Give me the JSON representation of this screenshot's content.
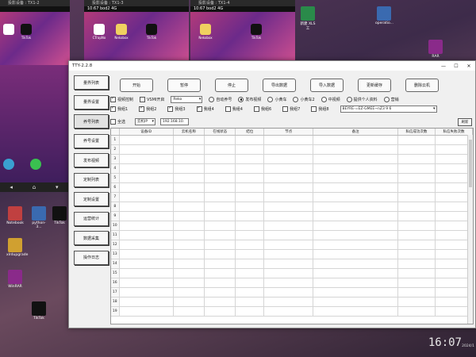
{
  "phones": [
    {
      "title": "投影设备 : TX1-2",
      "time": "",
      "apps": [
        {
          "label": ""
        },
        {
          "label": "TikTok"
        }
      ]
    },
    {
      "title": "投影设备 : TX1-3",
      "time": "10:67 bod2 4G",
      "apps": [
        {
          "label": "CTrapNo"
        },
        {
          "label": "TikTok"
        },
        {
          "label": "Nekobox"
        }
      ]
    },
    {
      "title": "投影设备 : TX1-4",
      "time": "10:67 bod2 4G",
      "apps": [
        {
          "label": "Nekobox"
        },
        {
          "label": "TikTok"
        }
      ]
    }
  ],
  "window": {
    "title": "TTY-2.2.8",
    "controls": {
      "min": "—",
      "max": "☐",
      "close": "✕"
    }
  },
  "sidebar": [
    {
      "label": "量界列表"
    },
    {
      "label": "量界设置"
    },
    {
      "label": "养号列表"
    },
    {
      "label": "养号设置"
    },
    {
      "label": "发布视频"
    },
    {
      "label": "定制列表"
    },
    {
      "label": "定制设置"
    },
    {
      "label": "运营统计"
    },
    {
      "label": "数据采集"
    },
    {
      "label": "操作日志"
    }
  ],
  "toolbar": [
    {
      "label": "开始"
    },
    {
      "label": "暂停"
    },
    {
      "label": "停止"
    },
    {
      "label": "导出数据"
    },
    {
      "label": "导入数据"
    },
    {
      "label": "更新缓存"
    },
    {
      "label": "删除云机"
    }
  ],
  "options_row1": {
    "cb1": "视频控制",
    "cb2": "VSMI开启",
    "select_value": "Reko",
    "r1": "自动养号",
    "r2": "发布视频",
    "r3": "小黄车",
    "r4": "小黄车2",
    "r5": "中视频",
    "r6": "提供个人资料",
    "r7": "营销"
  },
  "options_row2": {
    "cb1": "我组1",
    "cb2": "我组2",
    "cb3": "我组3",
    "cb4": "我组4",
    "cb5": "我组4",
    "cb6": "我组6",
    "cb7": "我组7",
    "cb8": "我组8",
    "select_value": "BEYRE-=EZ-GMEE~nZ3 9 6"
  },
  "filter_row": {
    "all": "全选",
    "ip_label": "云机IP",
    "ip_value": "192.168.10.",
    "refresh": "刷新"
  },
  "grid": {
    "columns": [
      "",
      "设备ID",
      "云机名称",
      "在线状态",
      "结位",
      "节点",
      "备注",
      "私信成功次数",
      "私信失败次数"
    ],
    "rows": [
      "1",
      "2",
      "3",
      "4",
      "5",
      "6",
      "7",
      "8",
      "9",
      "10",
      "11",
      "12",
      "13",
      "14",
      "15",
      "16",
      "17",
      "18",
      "19"
    ]
  },
  "desktop_icons": [
    {
      "label": "新建 XLS工"
    },
    {
      "label": "operatio..."
    },
    {
      "label": "RAR"
    },
    {
      "label": "Notebook"
    },
    {
      "label": "python-3..."
    },
    {
      "label": "TikTok"
    },
    {
      "label": "xlrdupgrade"
    },
    {
      "label": "WinRAR"
    },
    {
      "label": "TikTok"
    }
  ],
  "clock": {
    "time": "16:07",
    "date": "16:07\n2024/1"
  },
  "colors": {
    "accent": "#d05090",
    "window_bg": "#f0f0f0"
  }
}
